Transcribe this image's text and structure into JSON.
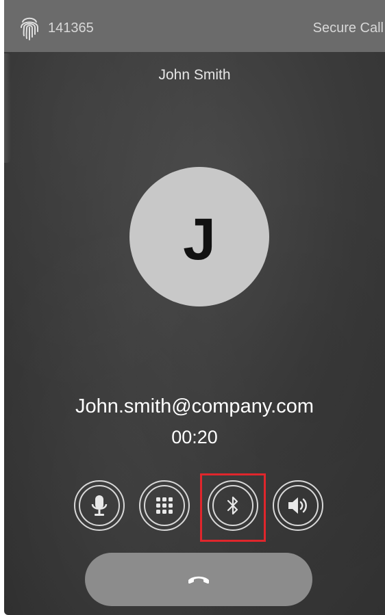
{
  "status_bar": {
    "call_id": "141365",
    "security_label": "Secure Call"
  },
  "caller": {
    "name": "John Smith",
    "initial": "J",
    "email": "John.smith@company.com",
    "duration": "00:20"
  },
  "controls": [
    {
      "name": "microphone",
      "icon": "microphone-icon"
    },
    {
      "name": "dialpad",
      "icon": "dialpad-icon"
    },
    {
      "name": "bluetooth",
      "icon": "bluetooth-icon",
      "highlighted": true
    },
    {
      "name": "speaker",
      "icon": "speaker-icon"
    }
  ],
  "end_call": {
    "icon": "end-call-icon"
  },
  "colors": {
    "highlight": "#e0262c",
    "avatar_bg": "#c8c8c8",
    "status_bar_bg": "#6b6b6b",
    "end_call_bg": "#8c8c8c"
  }
}
